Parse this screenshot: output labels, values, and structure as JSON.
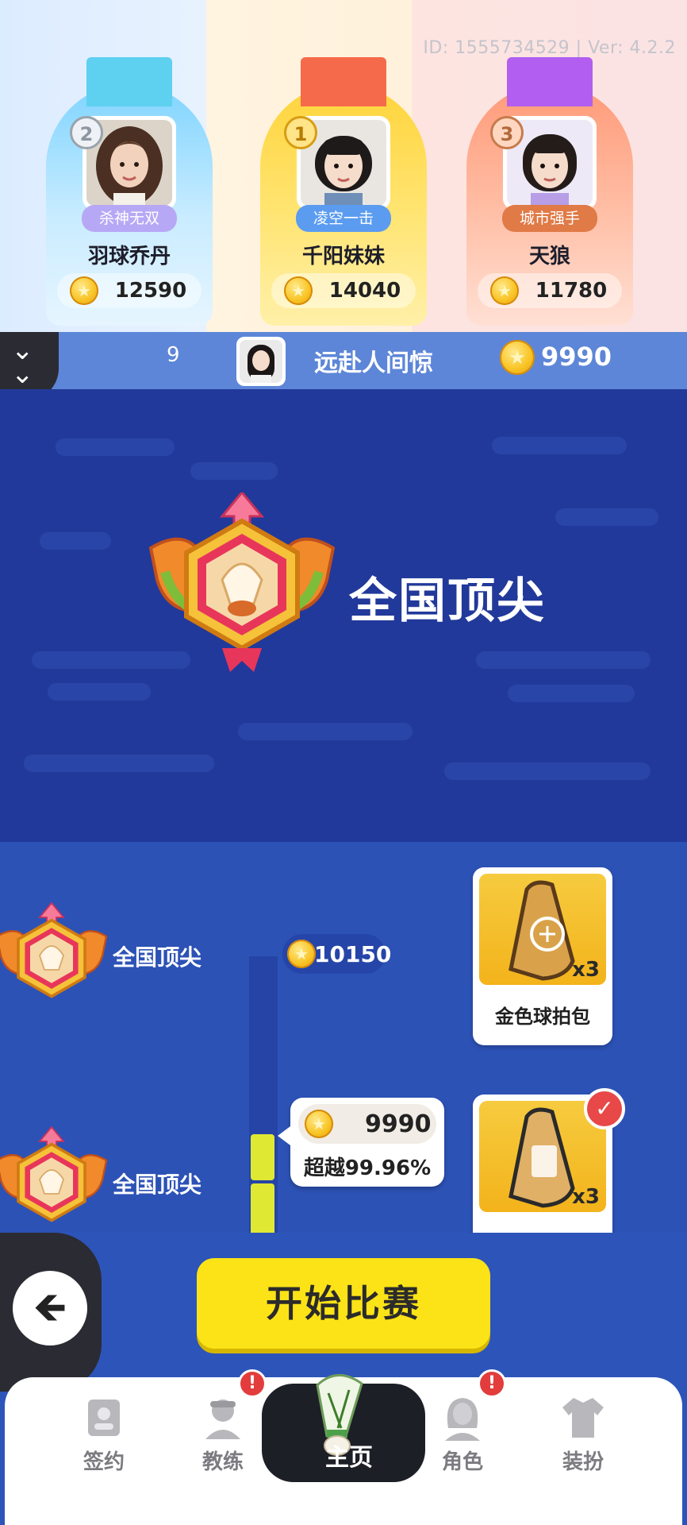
{
  "version_text": "ID: 1555734529 | Ver: 4.2.2",
  "podium": [
    {
      "rank": "2",
      "title_tag": "杀神无双",
      "name": "羽球乔丹",
      "score": "12590",
      "tag_color": "#9b8bf0"
    },
    {
      "rank": "1",
      "title_tag": "凌空一击",
      "name": "千阳妹妹",
      "score": "14040",
      "tag_color": "#4f8fe8"
    },
    {
      "rank": "3",
      "title_tag": "城市强手",
      "name": "天狼",
      "score": "11780",
      "tag_color": "#e06a3a"
    }
  ],
  "info_bar": {
    "rank": "9",
    "name": "远赴人间惊",
    "score": "9990",
    "collapse_icon": "double-chevron-down-icon"
  },
  "hero": {
    "tier_title": "全国顶尖",
    "badge_icon": "shuttlecock-tier-badge-icon"
  },
  "list": {
    "rows": [
      {
        "label": "全国顶尖",
        "score": "10150"
      },
      {
        "label": "全国顶尖"
      }
    ],
    "current_bubble": {
      "score": "9990",
      "surpass_text": "超越99.96%"
    },
    "rewards": [
      {
        "name": "金色球拍包",
        "qty": "x3",
        "claimed": false
      },
      {
        "name": "",
        "qty": "x3",
        "claimed": true
      }
    ]
  },
  "start_button": "开始比赛",
  "back_icon": "back-arrow-icon",
  "nav": [
    {
      "label": "签约",
      "icon": "contract-card-icon",
      "badge": ""
    },
    {
      "label": "教练",
      "icon": "coach-icon",
      "badge": "!"
    },
    {
      "label": "主页",
      "icon": "shuttlecock-icon",
      "badge": "",
      "active": true
    },
    {
      "label": "角色",
      "icon": "character-icon",
      "badge": "!"
    },
    {
      "label": "装扮",
      "icon": "outfit-icon",
      "badge": ""
    }
  ],
  "colors": {
    "accent_yellow": "#fbe317",
    "hero_blue": "#21399a",
    "list_blue": "#2c52b6",
    "badge_red": "#e33c3c"
  }
}
